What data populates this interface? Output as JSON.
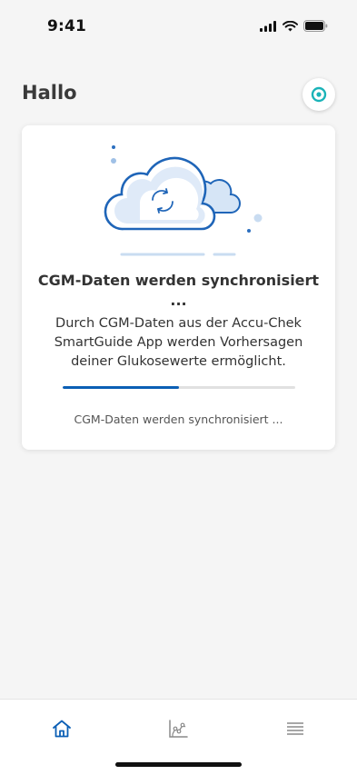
{
  "status_bar": {
    "time": "9:41"
  },
  "header": {
    "greeting": "Hallo"
  },
  "sync_card": {
    "title": "CGM-Daten werden synchronisiert ...",
    "description": "Durch CGM-Daten aus der Accu-Chek SmartGuide App werden Vorhersagen deiner Glukosewerte ermöglicht.",
    "progress": 0.5,
    "status_text": "CGM-Daten werden synchronisiert ..."
  },
  "bottom_nav": {
    "items": [
      {
        "icon": "home-icon",
        "active": true
      },
      {
        "icon": "chart-icon",
        "active": false
      },
      {
        "icon": "menu-icon",
        "active": false
      }
    ]
  },
  "colors": {
    "accent": "#0b5fb5",
    "sensor": "#1ab3b8",
    "cloud_fill": "#dbe8f7",
    "background": "#f5f5f5"
  }
}
